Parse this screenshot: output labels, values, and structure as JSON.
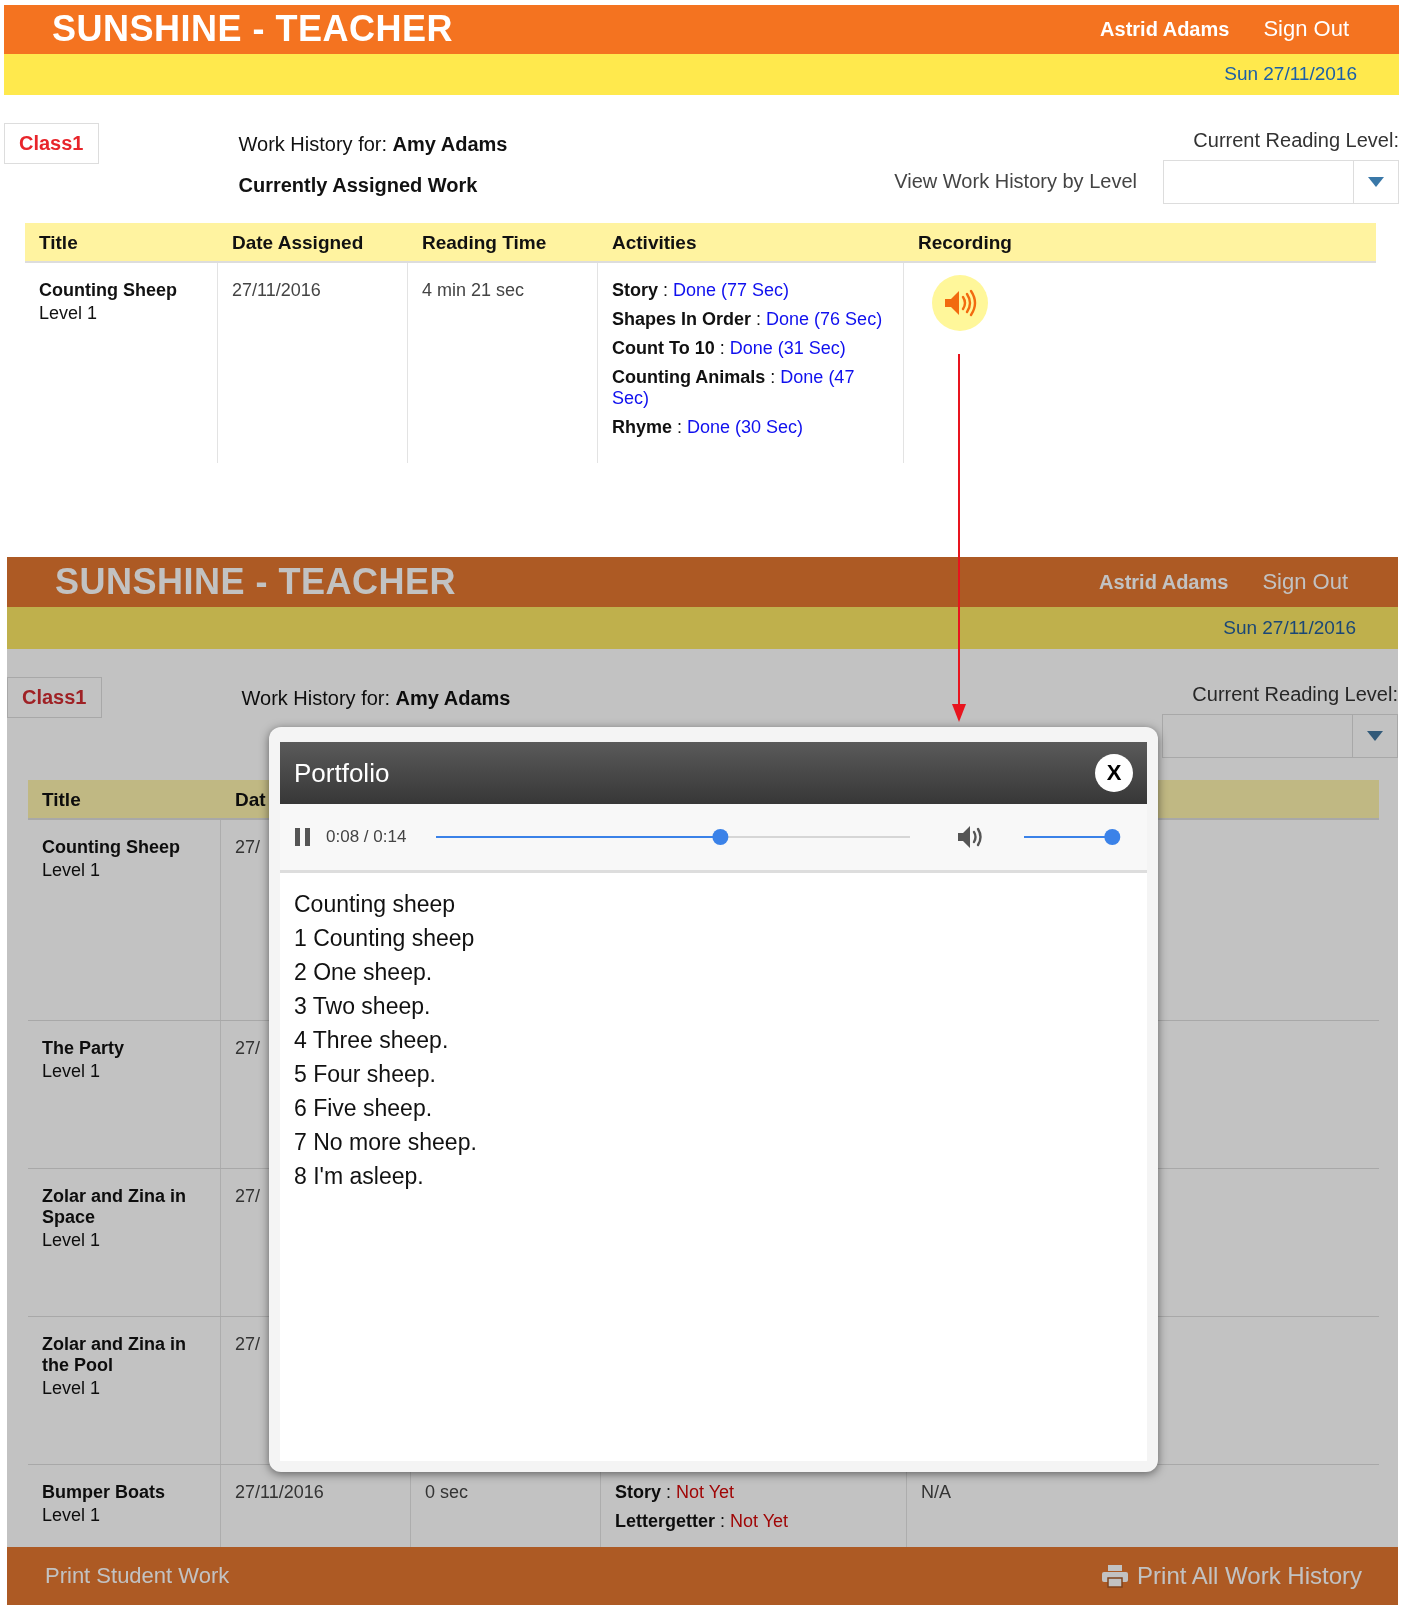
{
  "screens": [
    {
      "header": {
        "title": "SUNSHINE - TEACHER",
        "user": "Astrid Adams",
        "sign_out": "Sign Out",
        "date": "Sun 27/11/2016"
      },
      "class_tab": "Class1",
      "work_history_label": "Work History for:",
      "student_name": "Amy Adams",
      "assigned_label": "Currently Assigned Work",
      "view_by_level": "View Work History by Level",
      "reading_level_label": "Current Reading Level:",
      "table": {
        "columns": [
          "Title",
          "Date Assigned",
          "Reading Time",
          "Activities",
          "Recording"
        ],
        "rows": [
          {
            "title": "Counting Sheep",
            "level": "Level 1",
            "date": "27/11/2016",
            "reading_time": "4 min 21 sec",
            "activities": [
              {
                "name": "Story",
                "separator": ":",
                "status": "Done (77 Sec)",
                "kind": "done"
              },
              {
                "name": "Shapes In Order",
                "separator": ":",
                "status": "Done (76 Sec)",
                "kind": "done"
              },
              {
                "name": "Count To 10",
                "separator": ":",
                "status": "Done (31 Sec)",
                "kind": "done"
              },
              {
                "name": "Counting Animals",
                "separator": ":",
                "status": "Done (47 Sec)",
                "kind": "done"
              },
              {
                "name": "Rhyme",
                "separator": ":",
                "status": "Done (30 Sec)",
                "kind": "done"
              }
            ],
            "recording": {
              "kind": "audio"
            }
          }
        ]
      }
    },
    {
      "header": {
        "title": "SUNSHINE - TEACHER",
        "user": "Astrid Adams",
        "sign_out": "Sign Out",
        "date": "Sun 27/11/2016"
      },
      "class_tab": "Class1",
      "work_history_label": "Work History for:",
      "student_name": "Amy Adams",
      "reading_level_label": "Current Reading Level:",
      "table": {
        "columns": [
          "Title",
          "Dat"
        ],
        "rows": [
          {
            "title": "Counting Sheep",
            "level": "Level 1",
            "date": "27/"
          },
          {
            "title": "The Party",
            "level": "Level 1",
            "date": "27/"
          },
          {
            "title": "Zolar and Zina in Space",
            "level": "Level 1",
            "date": "27/"
          },
          {
            "title": "Zolar and Zina in the Pool",
            "level": "Level 1",
            "date": "27/"
          },
          {
            "title": "Bumper Boats",
            "level": "Level 1",
            "date": "27/11/2016",
            "reading_time": "0 sec",
            "activities": [
              {
                "name": "Story",
                "separator": ":",
                "status": "Not Yet",
                "kind": "not_yet"
              },
              {
                "name": "Lettergetter",
                "separator": ":",
                "status": "Not Yet",
                "kind": "not_yet"
              }
            ],
            "recording": {
              "kind": "text",
              "text": "N/A"
            }
          }
        ]
      },
      "footer": {
        "print_student": "Print Student Work",
        "print_all": "Print All Work History"
      }
    }
  ],
  "modal": {
    "title": "Portfolio",
    "close": "X",
    "time": "0:08 / 0:14",
    "progress": {
      "level": 0.6
    },
    "volume": {
      "level": 0.92
    },
    "lines": [
      "Counting sheep",
      "1 Counting sheep",
      "2 One sheep.",
      "3 Two sheep.",
      "4 Three sheep.",
      "5 Four sheep.",
      "6 Five sheep.",
      "7 No more sheep.",
      "8 I'm asleep."
    ]
  }
}
